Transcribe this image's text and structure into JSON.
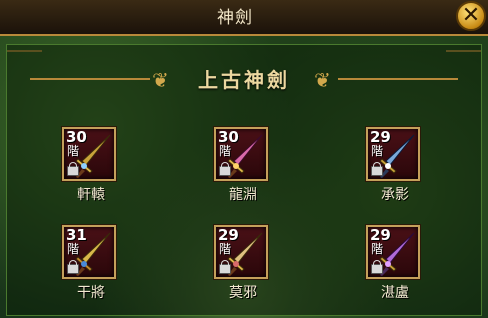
{
  "window": {
    "title": "神劍"
  },
  "section": {
    "title": "上古神劍"
  },
  "swords": [
    {
      "level": "30",
      "rank": "階",
      "name": "軒轅",
      "blade_color": "#c9a23a",
      "gem_color": "#8ed0ff"
    },
    {
      "level": "30",
      "rank": "階",
      "name": "龍淵",
      "blade_color": "#d86aa8",
      "gem_color": "#ffd36a"
    },
    {
      "level": "29",
      "rank": "階",
      "name": "承影",
      "blade_color": "#7aa8d8",
      "gem_color": "#ffffff"
    },
    {
      "level": "31",
      "rank": "階",
      "name": "干將",
      "blade_color": "#d8b84a",
      "gem_color": "#4a8ad8"
    },
    {
      "level": "29",
      "rank": "階",
      "name": "莫邪",
      "blade_color": "#e0c080",
      "gem_color": "#d86a6a"
    },
    {
      "level": "29",
      "rank": "階",
      "name": "湛盧",
      "blade_color": "#b06ad8",
      "gem_color": "#e0a0ff"
    }
  ]
}
